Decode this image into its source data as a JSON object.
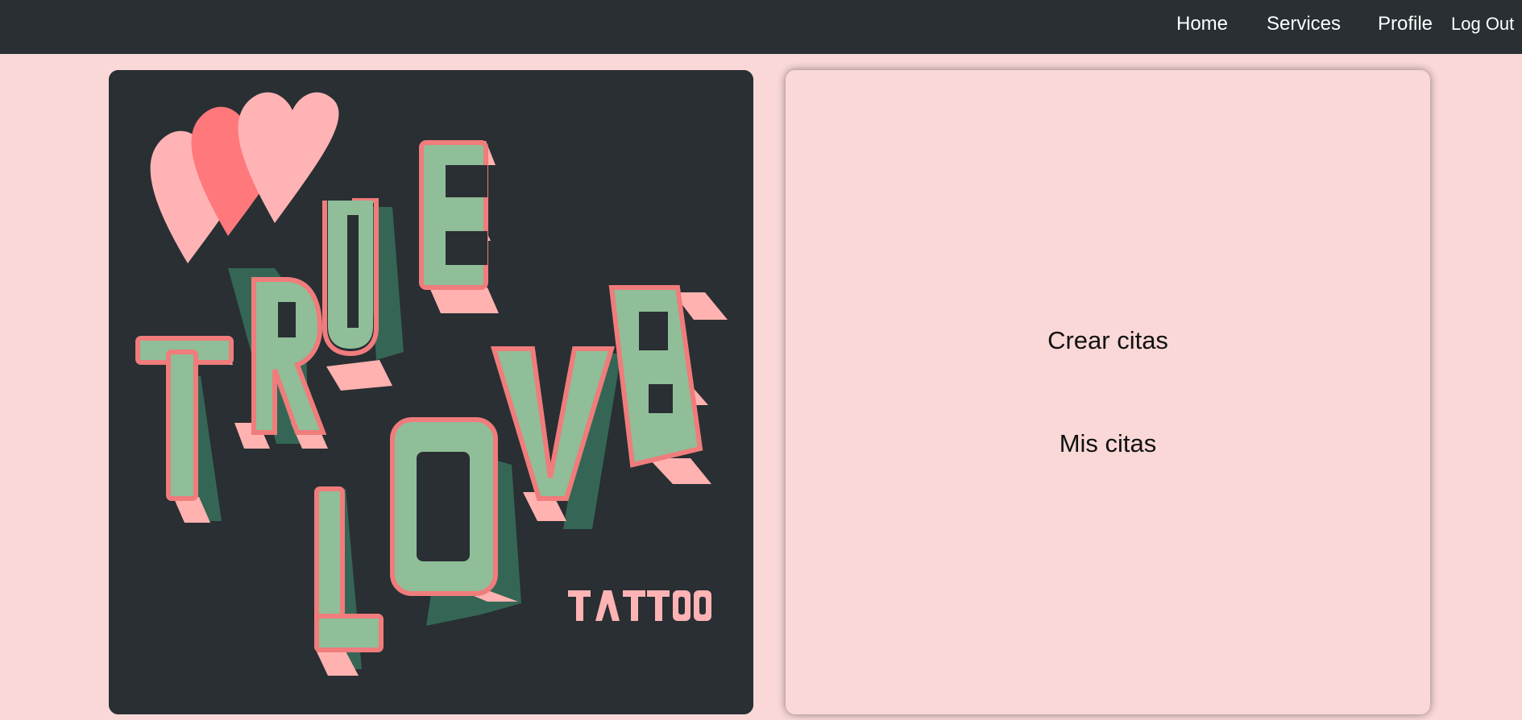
{
  "nav": {
    "home": "Home",
    "services": "Services",
    "profile": "Profile",
    "logout": "Log Out"
  },
  "poster": {
    "logo_text": "TRUE LOVE TATTOO"
  },
  "actions": {
    "crear": "Crear citas",
    "mis": "Mis citas"
  },
  "colors": {
    "navbar": "#292f33",
    "page_background": "#f9d8d7",
    "poster_background": "#292f33",
    "letter_green": "#8fbe98",
    "letter_outline": "#f07c7c",
    "letter_pink_shadow": "#ffb2b0",
    "letter_dark_extrude": "#356655",
    "heart_light": "#ffb3b5",
    "heart_dark": "#ff787b"
  }
}
